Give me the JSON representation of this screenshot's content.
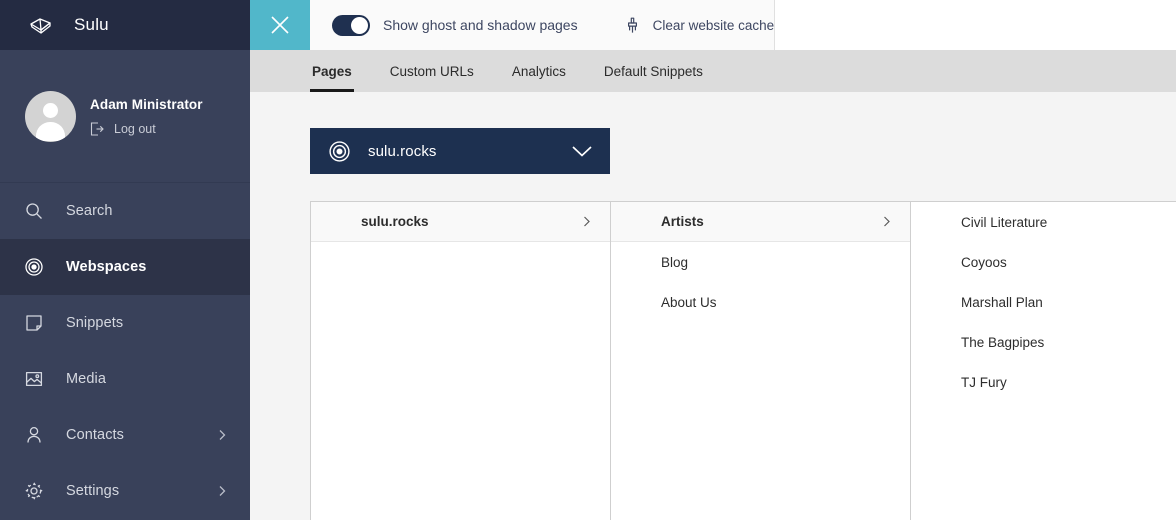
{
  "brand": {
    "name": "Sulu",
    "logo_icon": "sulu-cube-icon"
  },
  "user": {
    "name": "Adam Ministrator",
    "logout_label": "Log out",
    "logout_icon": "logout-icon",
    "avatar_icon": "user-avatar"
  },
  "sidebar": {
    "items": [
      {
        "label": "Search",
        "icon": "search-icon",
        "active": false,
        "expandable": false
      },
      {
        "label": "Webspaces",
        "icon": "target-icon",
        "active": true,
        "expandable": false
      },
      {
        "label": "Snippets",
        "icon": "snippet-icon",
        "active": false,
        "expandable": false
      },
      {
        "label": "Media",
        "icon": "image-icon",
        "active": false,
        "expandable": false
      },
      {
        "label": "Contacts",
        "icon": "person-icon",
        "active": false,
        "expandable": true
      },
      {
        "label": "Settings",
        "icon": "gear-icon",
        "active": false,
        "expandable": true
      }
    ]
  },
  "toolbar": {
    "close_icon": "close-icon",
    "ghost_toggle": {
      "label": "Show ghost and shadow pages",
      "checked": true
    },
    "clear_cache": {
      "label": "Clear website cache",
      "icon": "brush-icon"
    }
  },
  "tabs": [
    {
      "label": "Pages",
      "active": true
    },
    {
      "label": "Custom URLs",
      "active": false
    },
    {
      "label": "Analytics",
      "active": false
    },
    {
      "label": "Default Snippets",
      "active": false
    }
  ],
  "webspace_select": {
    "value": "sulu.rocks",
    "icon": "target-icon",
    "caret_icon": "chevron-down-icon"
  },
  "column_browser": {
    "columns": [
      {
        "items": [
          {
            "label": "sulu.rocks",
            "selected": true,
            "has_children": true
          }
        ]
      },
      {
        "items": [
          {
            "label": "Artists",
            "selected": true,
            "has_children": true
          },
          {
            "label": "Blog",
            "selected": false,
            "has_children": false
          },
          {
            "label": "About Us",
            "selected": false,
            "has_children": false
          }
        ]
      },
      {
        "items": [
          {
            "label": "Civil Literature",
            "selected": false,
            "has_children": false
          },
          {
            "label": "Coyoos",
            "selected": false,
            "has_children": false
          },
          {
            "label": "Marshall Plan",
            "selected": false,
            "has_children": false
          },
          {
            "label": "The Bagpipes",
            "selected": false,
            "has_children": false
          },
          {
            "label": "TJ Fury",
            "selected": false,
            "has_children": false
          }
        ]
      }
    ]
  },
  "colors": {
    "brand_dark": "#242b42",
    "sidebar": "#39415a",
    "sidebar_active": "#2d3348",
    "accent_teal": "#51b7ca",
    "select_navy": "#1d3050",
    "tabbar_gray": "#dcdcdc",
    "page_bg": "#f4f4f4"
  }
}
